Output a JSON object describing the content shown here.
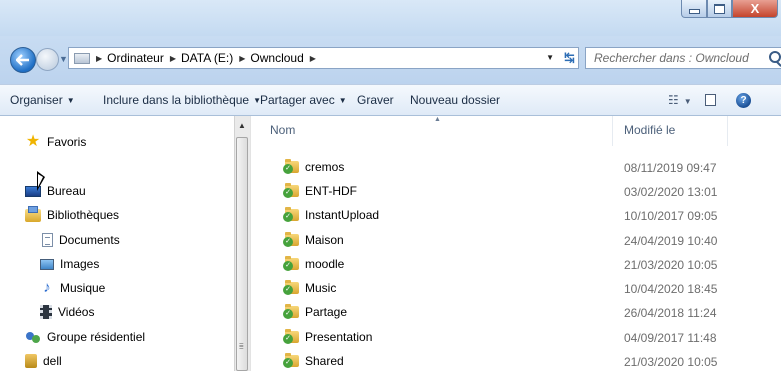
{
  "window": {
    "controls": {
      "minimize": "",
      "maximize": "",
      "close": "X"
    }
  },
  "address_bar": {
    "breadcrumbs": [
      {
        "label": "Ordinateur"
      },
      {
        "label": "DATA (E:)"
      },
      {
        "label": "Owncloud"
      }
    ],
    "search_placeholder": "Rechercher dans : Owncloud"
  },
  "toolbar": {
    "organize": "Organiser",
    "include_library": "Inclure dans la bibliothèque",
    "share_with": "Partager avec",
    "burn": "Graver",
    "new_folder": "Nouveau dossier",
    "help": "?"
  },
  "navigation": {
    "favorites": "Favoris",
    "desktop": "Bureau",
    "libraries": "Bibliothèques",
    "documents": "Documents",
    "images": "Images",
    "music": "Musique",
    "videos": "Vidéos",
    "homegroup": "Groupe résidentiel",
    "user": "dell"
  },
  "columns": {
    "name": "Nom",
    "modified": "Modifié le"
  },
  "files": [
    {
      "name": "cremos",
      "modified": "08/11/2019 09:47"
    },
    {
      "name": "ENT-HDF",
      "modified": "03/02/2020 13:01"
    },
    {
      "name": "InstantUpload",
      "modified": "10/10/2017 09:05"
    },
    {
      "name": "Maison",
      "modified": "24/04/2019 10:40"
    },
    {
      "name": "moodle",
      "modified": "21/03/2020 10:05"
    },
    {
      "name": "Music",
      "modified": "10/04/2020 18:45"
    },
    {
      "name": "Partage",
      "modified": "26/04/2018 11:24"
    },
    {
      "name": "Presentation",
      "modified": "04/09/2017 11:48"
    },
    {
      "name": "Shared",
      "modified": "21/03/2020 10:05"
    }
  ],
  "colors": {
    "titlebar": "#c4daf1",
    "toolbar": "#dfeaf7",
    "sync_ok": "#46a23c",
    "folder": "#d9a630"
  }
}
